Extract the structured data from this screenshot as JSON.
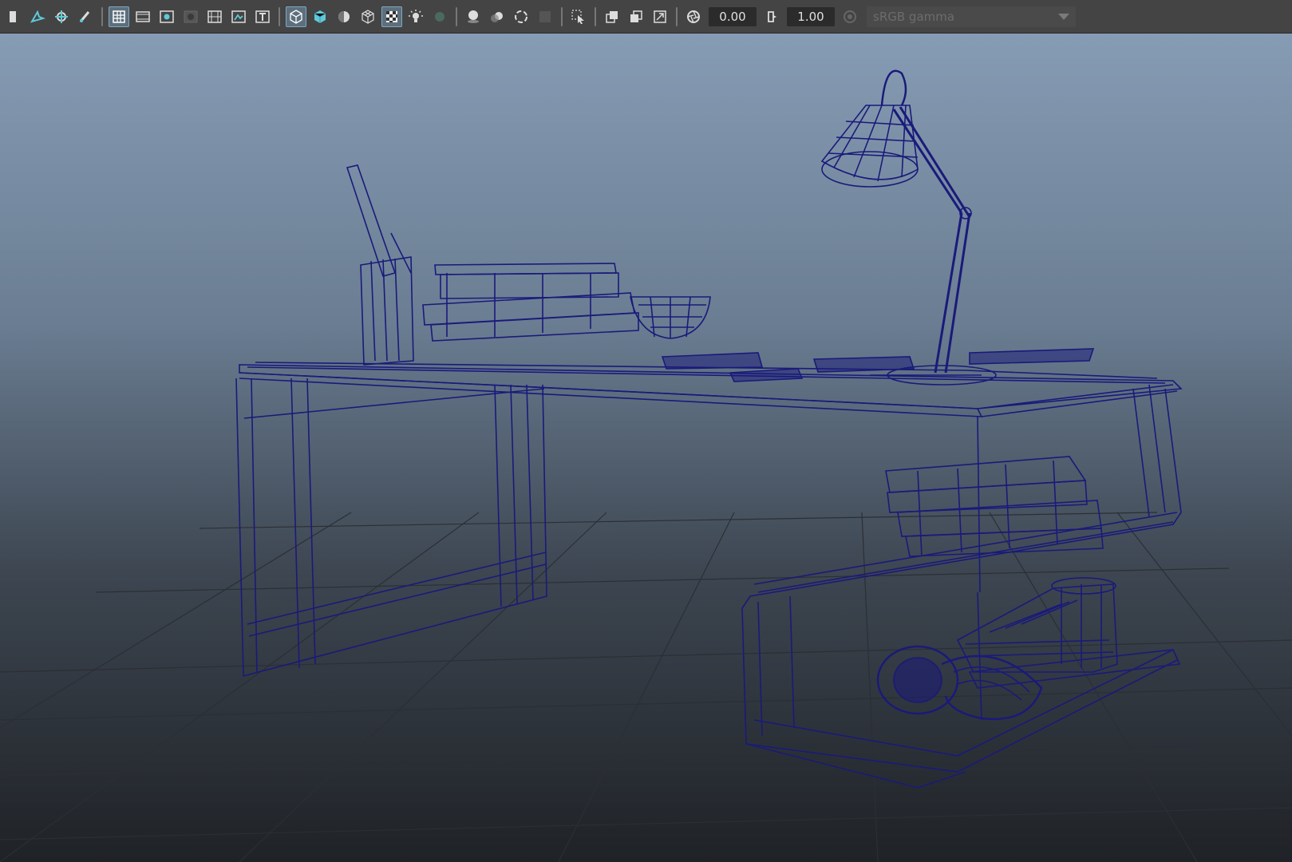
{
  "toolbar": {
    "exposure_value": "0.00",
    "gamma_value": "1.00",
    "color_space": "sRGB gamma",
    "icons": [
      "bookmark-icon",
      "camera-attributes-icon",
      "select-camera-icon",
      "brush-icon",
      "grid-icon",
      "film-gate-icon",
      "resolution-gate-icon",
      "gate-mask-icon",
      "field-chart-icon",
      "safe-action-icon",
      "safe-title-icon",
      "wireframe-icon",
      "smooth-shade-icon",
      "flat-shade-icon",
      "wireframe-on-shaded-icon",
      "textured-icon",
      "lights-icon",
      "shadows-icon",
      "screen-space-ao-icon",
      "motion-blur-icon",
      "anti-aliasing-icon",
      "depth-of-field-icon",
      "isolate-select-icon",
      "xray-icon",
      "xray-active-icon",
      "xray-joints-icon",
      "exposure-icon",
      "gamma-icon",
      "color-management-icon"
    ]
  },
  "viewport": {
    "background_top": "#869cb4",
    "background_bottom": "#1f2226",
    "wireframe_color": "#1a1a7a",
    "grid_color": "#2b2f35"
  }
}
